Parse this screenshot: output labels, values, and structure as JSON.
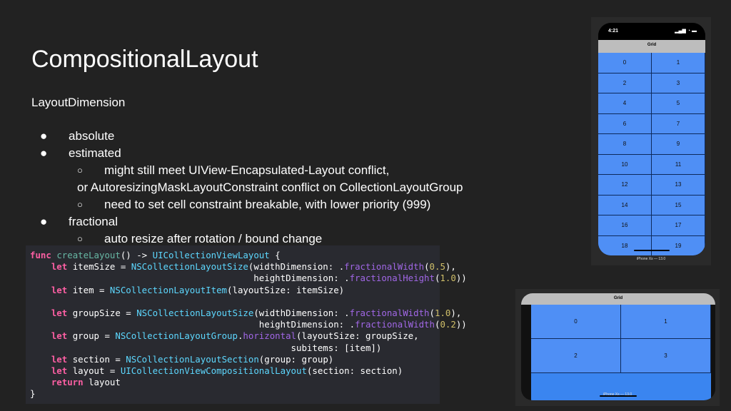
{
  "slide": {
    "title": "CompositionalLayout",
    "subtitle": "LayoutDimension"
  },
  "bullets": {
    "dot_primary": "●",
    "dot_secondary": "○",
    "absolute": "absolute",
    "estimated": "estimated",
    "estimated_sub1_line1": "might still meet UIView-Encapsulated-Layout conflict,",
    "estimated_sub1_line2": "or AutoresizingMaskLayoutConstraint conflict on CollectionLayoutGroup",
    "estimated_sub2": "need to set cell constraint breakable, with lower priority (999)",
    "fractional": "fractional",
    "fractional_sub1": "auto resize after rotation / bound change"
  },
  "code": {
    "lines": [
      [
        [
          "kw",
          "func "
        ],
        [
          "fn",
          "createLayout"
        ],
        [
          "",
          "() -> "
        ],
        [
          "tp",
          "UICollectionViewLayout"
        ],
        [
          "",
          " {"
        ]
      ],
      [
        [
          "",
          "    "
        ],
        [
          "kw",
          "let "
        ],
        [
          "",
          "itemSize = "
        ],
        [
          "tp",
          "NSCollectionLayoutSize"
        ],
        [
          "",
          "(widthDimension: ."
        ],
        [
          "mt",
          "fractionalWidth"
        ],
        [
          "",
          "("
        ],
        [
          "nm",
          "0.5"
        ],
        [
          "",
          "),"
        ]
      ],
      [
        [
          "",
          "                                          heightDimension: ."
        ],
        [
          "mt",
          "fractionalHeight"
        ],
        [
          "",
          "("
        ],
        [
          "nm",
          "1.0"
        ],
        [
          "",
          "))"
        ]
      ],
      [
        [
          "",
          "    "
        ],
        [
          "kw",
          "let "
        ],
        [
          "",
          "item = "
        ],
        [
          "tp",
          "NSCollectionLayoutItem"
        ],
        [
          "",
          "(layoutSize: itemSize)"
        ]
      ],
      [
        [
          "",
          ""
        ]
      ],
      [
        [
          "",
          "    "
        ],
        [
          "kw",
          "let "
        ],
        [
          "",
          "groupSize = "
        ],
        [
          "tp",
          "NSCollectionLayoutSize"
        ],
        [
          "",
          "(widthDimension: ."
        ],
        [
          "mt",
          "fractionalWidth"
        ],
        [
          "",
          "("
        ],
        [
          "nm",
          "1.0"
        ],
        [
          "",
          "),"
        ]
      ],
      [
        [
          "",
          "                                           heightDimension: ."
        ],
        [
          "mt",
          "fractionalWidth"
        ],
        [
          "",
          "("
        ],
        [
          "nm",
          "0.2"
        ],
        [
          "",
          "))"
        ]
      ],
      [
        [
          "",
          "    "
        ],
        [
          "kw",
          "let "
        ],
        [
          "",
          "group = "
        ],
        [
          "tp",
          "NSCollectionLayoutGroup"
        ],
        [
          "",
          "."
        ],
        [
          "mt",
          "horizontal"
        ],
        [
          "",
          "(layoutSize: groupSize,"
        ]
      ],
      [
        [
          "",
          "                                                 subitems: [item])"
        ]
      ],
      [
        [
          "",
          "    "
        ],
        [
          "kw",
          "let "
        ],
        [
          "",
          "section = "
        ],
        [
          "tp",
          "NSCollectionLayoutSection"
        ],
        [
          "",
          "(group: group)"
        ]
      ],
      [
        [
          "",
          "    "
        ],
        [
          "kw",
          "let "
        ],
        [
          "",
          "layout = "
        ],
        [
          "tp",
          "UICollectionViewCompositionalLayout"
        ],
        [
          "",
          "(section: section)"
        ]
      ],
      [
        [
          "",
          "    "
        ],
        [
          "kw",
          "return "
        ],
        [
          "",
          "layout"
        ]
      ],
      [
        [
          "",
          "}"
        ]
      ]
    ]
  },
  "portrait_phone": {
    "time": "4:21",
    "status_icons": "▂▄▆ ◔ ▬",
    "nav_title": "Grid",
    "cells": [
      "0",
      "1",
      "2",
      "3",
      "4",
      "5",
      "6",
      "7",
      "8",
      "9",
      "10",
      "11",
      "12",
      "13",
      "14",
      "15",
      "16",
      "17",
      "18",
      "19"
    ],
    "caption": "iPhone Xs — 13.0"
  },
  "landscape_phone": {
    "nav_title": "Grid",
    "cells": [
      "0",
      "1",
      "2",
      "3"
    ],
    "caption": "iPhone Xs — 13.0"
  }
}
